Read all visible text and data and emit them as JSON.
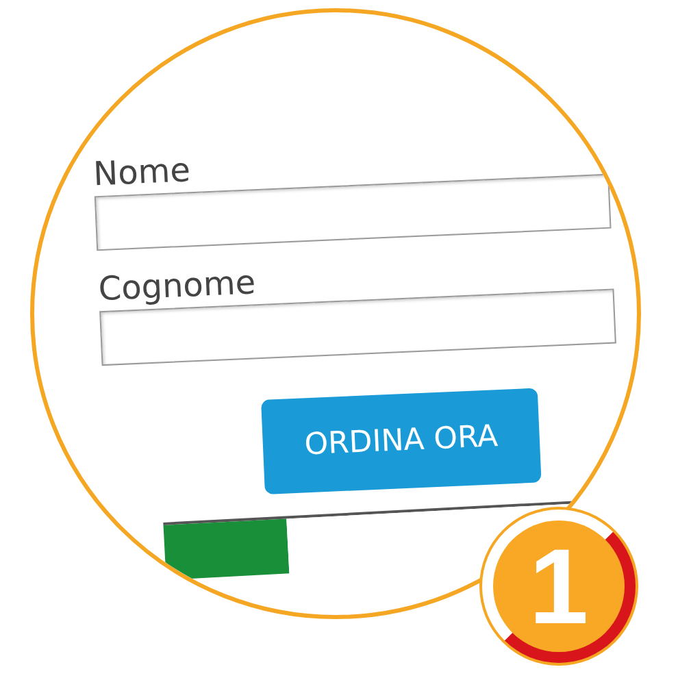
{
  "form": {
    "fields": [
      {
        "label": "Nome"
      },
      {
        "label": "Cognome"
      }
    ],
    "button": "ORDINA ORA"
  },
  "badge": "1"
}
